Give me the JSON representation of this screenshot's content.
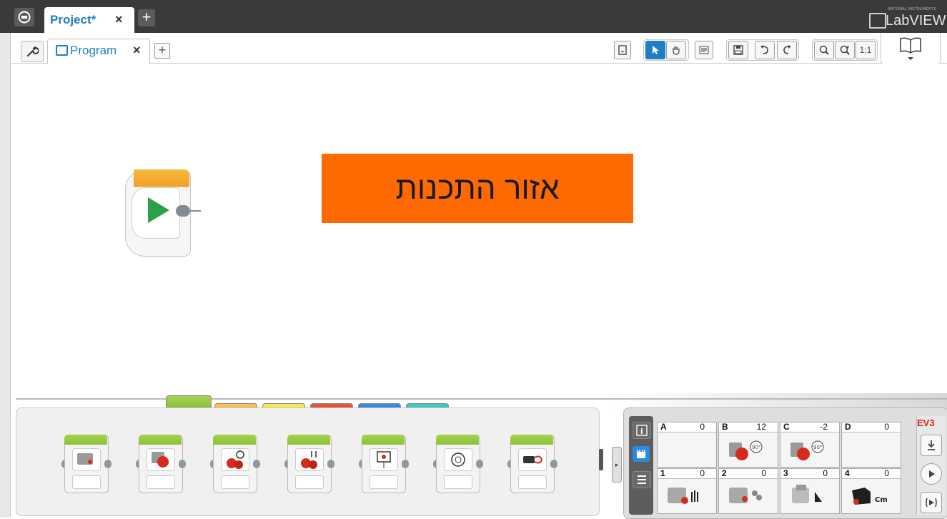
{
  "project_tab": {
    "label": "Project*",
    "close": "×",
    "add": "+"
  },
  "brand": {
    "small": "NATIONAL INSTRUMENTS",
    "name": "LabVIEW"
  },
  "program_tab": {
    "label": "Program",
    "close": "×",
    "add": "+"
  },
  "toolbar": {
    "zoom_reset": "1:1",
    "icons": [
      "page-icon",
      "select-arrow-icon",
      "pan-hand-icon",
      "comment-icon",
      "save-icon",
      "undo-icon",
      "redo-icon",
      "zoom-out-icon",
      "zoom-in-icon",
      "zoom-reset-icon",
      "content-editor-book-icon"
    ]
  },
  "canvas": {
    "annotation_text": "אזור התכנות",
    "annotation_color": "#ff6a00",
    "start_block": {
      "icon": "start-play-icon",
      "color": "#f2a12a"
    }
  },
  "palette": {
    "tabs": [
      {
        "name": "action",
        "color": "#8cc03a",
        "selected": true
      },
      {
        "name": "flow",
        "color": "#f5a623",
        "selected": false
      },
      {
        "name": "sensor",
        "color": "#f3df1b",
        "selected": false
      },
      {
        "name": "data",
        "color": "#d8331b",
        "selected": false
      },
      {
        "name": "advanced",
        "color": "#1e6fc9",
        "selected": false
      },
      {
        "name": "myblocks",
        "color": "#22b5b0",
        "selected": false
      }
    ],
    "blocks": [
      "medium-motor-block",
      "large-motor-block",
      "move-steering-block",
      "move-tank-block",
      "display-block",
      "sound-block",
      "brick-status-light-block"
    ]
  },
  "hardware": {
    "ev3_label": "EV3",
    "motor_ports": [
      {
        "id": "A",
        "value": "0"
      },
      {
        "id": "B",
        "value": "12"
      },
      {
        "id": "C",
        "value": "-2"
      },
      {
        "id": "D",
        "value": "0"
      }
    ],
    "sensor_ports": [
      {
        "id": "1",
        "value": "0",
        "unit": ""
      },
      {
        "id": "2",
        "value": "0",
        "unit": ""
      },
      {
        "id": "3",
        "value": "0",
        "unit": ""
      },
      {
        "id": "4",
        "value": "0",
        "unit": "Cm"
      }
    ],
    "motor_badge": "90°"
  }
}
